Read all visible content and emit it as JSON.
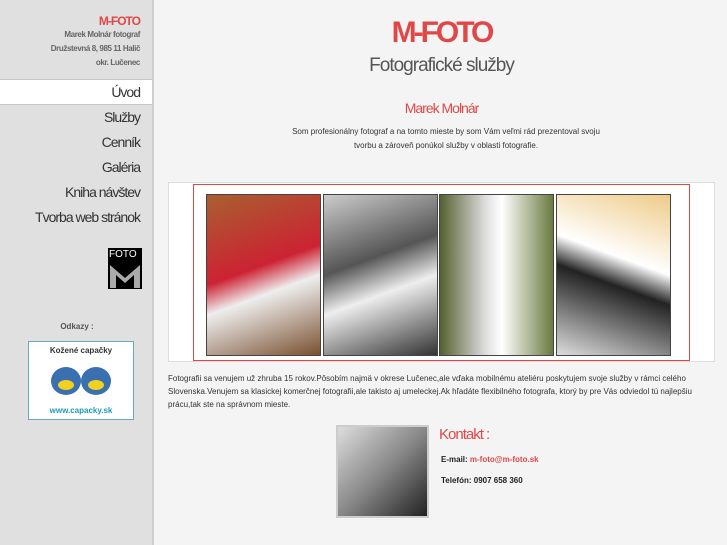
{
  "sidebar": {
    "brand": "M-FOTO",
    "lines": [
      "Marek Molnár fotograf",
      "Družstevná 8, 985 11 Halič",
      "okr. Lučenec"
    ],
    "nav": [
      "Úvod",
      "Služby",
      "Cenník",
      "Galéria",
      "Kniha návštev",
      "Tvorba web stránok"
    ],
    "logo_text": "FOTO",
    "links_label": "Odkazy :",
    "banner_title": "Kožené capačky",
    "banner_url": "www.capacky.sk"
  },
  "header": {
    "title": "M-FOTO",
    "subtitle": "Fotografické služby"
  },
  "intro": {
    "name": "Marek Molnár",
    "text": "Som profesionálny fotograf a na tomto mieste by som Vám veľmi rád prezentoval svoju tvorbu a zároveň ponúkol služby v oblasti fotografie."
  },
  "body": "Fotografii sa venujem už zhruba 15 rokov.Pôsobím najmä v okrese Lučenec,ale vďaka mobilnému ateliéru poskytujem svoje služby v rámci celého Slovenska.Venujem sa klasickej komerčnej fotografii,ale takisto aj umeleckej.Ak hľadáte flexibilného fotografa, ktorý by pre Vás odviedol tú najlepšiu prácu,tak ste na správnom mieste.",
  "contact": {
    "title": "Kontakt :",
    "email_label": "E-mail:",
    "email": "m-foto@m-foto.sk",
    "phone_label": "Telefón:",
    "phone": "0907 658 360"
  }
}
